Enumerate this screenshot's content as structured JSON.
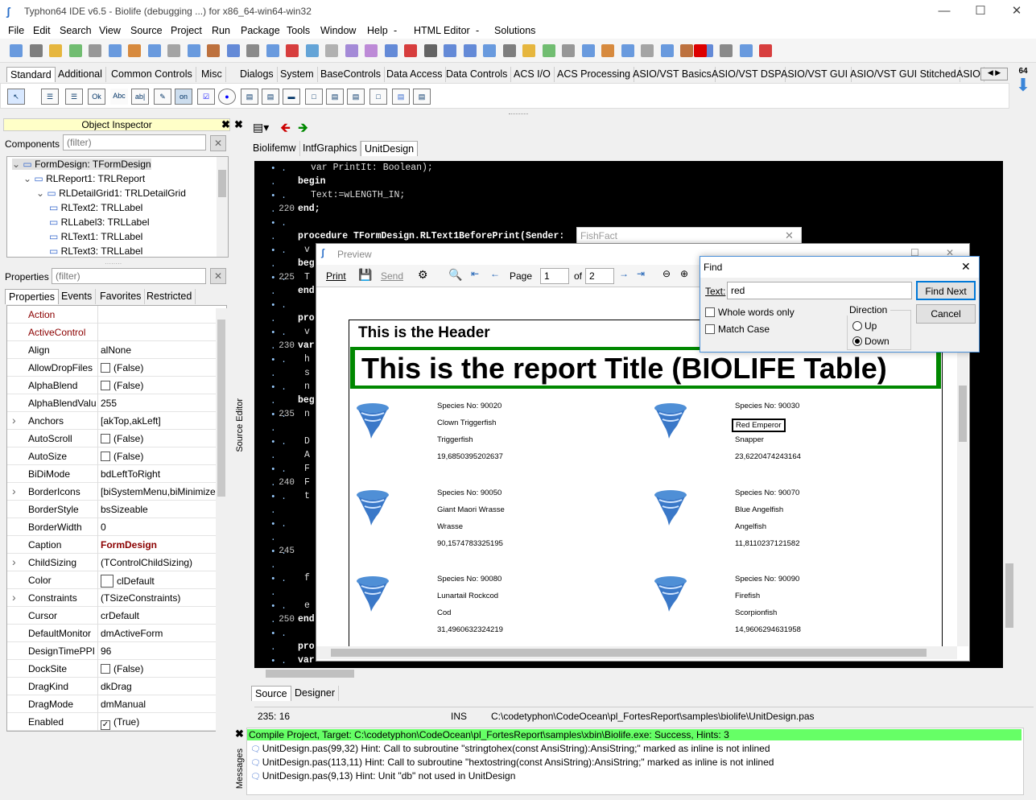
{
  "window": {
    "title": "Typhon64 IDE v6.5 - Biolife (debugging ...) for x86_64-win64-win32"
  },
  "menu": [
    "File",
    "Edit",
    "Search",
    "View",
    "Source",
    "Project",
    "Run",
    "Package",
    "Tools",
    "Window",
    "Help",
    "-",
    "HTML Editor",
    "-",
    "Solutions"
  ],
  "palette_tabs": [
    "Standard",
    "Additional",
    "Common Controls",
    "Misc",
    "Dialogs",
    "System",
    "BaseControls",
    "Data Access",
    "Data Controls",
    "ACS I/O",
    "ACS Processing",
    "ASIO/VST Basics",
    "ASIO/VST DSP",
    "ASIO/VST GUI",
    "ASIO/VST GUI Stitched",
    "ASIO"
  ],
  "palette_badge": "64",
  "palette_icons": [
    "Ok",
    "Abc",
    "ab|",
    "on"
  ],
  "object_inspector": {
    "title": "Object Inspector",
    "components_label": "Components",
    "filter_placeholder": "(filter)",
    "tree": [
      "FormDesign: TFormDesign",
      "RLReport1: TRLReport",
      "RLDetailGrid1: TRLDetailGrid",
      "RLText2: TRLLabel",
      "RLLabel3: TRLLabel",
      "RLText1: TRLLabel",
      "RLText3: TRLLabel"
    ],
    "properties_label": "Properties",
    "tabs": [
      "Properties",
      "Events",
      "Favorites",
      "Restricted"
    ],
    "rows": [
      {
        "n": "Action",
        "v": ""
      },
      {
        "n": "ActiveControl",
        "v": ""
      },
      {
        "n": "Align",
        "v": "alNone"
      },
      {
        "n": "AllowDropFiles",
        "v": "(False)"
      },
      {
        "n": "AlphaBlend",
        "v": "(False)"
      },
      {
        "n": "AlphaBlendValu",
        "v": "255"
      },
      {
        "n": "Anchors",
        "v": "[akTop,akLeft]"
      },
      {
        "n": "AutoScroll",
        "v": "(False)"
      },
      {
        "n": "AutoSize",
        "v": "(False)"
      },
      {
        "n": "BiDiMode",
        "v": "bdLeftToRight"
      },
      {
        "n": "BorderIcons",
        "v": "[biSystemMenu,biMinimize"
      },
      {
        "n": "BorderStyle",
        "v": "bsSizeable"
      },
      {
        "n": "BorderWidth",
        "v": "0"
      },
      {
        "n": "Caption",
        "v": "FormDesign"
      },
      {
        "n": "ChildSizing",
        "v": "(TControlChildSizing)"
      },
      {
        "n": "Color",
        "v": "clDefault"
      },
      {
        "n": "Constraints",
        "v": "(TSizeConstraints)"
      },
      {
        "n": "Cursor",
        "v": "crDefault"
      },
      {
        "n": "DefaultMonitor",
        "v": "dmActiveForm"
      },
      {
        "n": "DesignTimePPI",
        "v": "96"
      },
      {
        "n": "DockSite",
        "v": "(False)"
      },
      {
        "n": "DragKind",
        "v": "dkDrag"
      },
      {
        "n": "DragMode",
        "v": "dmManual"
      },
      {
        "n": "Enabled",
        "v": "(True)"
      }
    ]
  },
  "source_editor": {
    "side_label": "Source Editor",
    "tabs": [
      "Biolifemw",
      "IntfGraphics",
      "UnitDesign"
    ],
    "bottom_tabs": [
      "Source",
      "Designer"
    ],
    "gutter": [
      "220",
      "225",
      "230",
      "235",
      "240",
      "245",
      "250"
    ],
    "lines": [
      "var PrintIt: Boolean);",
      "begin",
      "Text:=wLENGTH_IN;",
      "end;",
      "procedure TFormDesign.RLText1BeforePrint(Sender: ",
      "v",
      "beg",
      "T",
      "end",
      "pro",
      "v",
      "var",
      "h",
      "s",
      "n",
      "beg",
      "n",
      "D",
      "A",
      "F",
      "F",
      "t",
      "f",
      "e",
      "end",
      "pro",
      "var"
    ]
  },
  "fishfact": {
    "title": "FishFact"
  },
  "preview": {
    "title": "Preview",
    "print": "Print",
    "send": "Send",
    "page_label": "Page",
    "page": "1",
    "of_label": "of",
    "total": "2",
    "header": "This is the Header",
    "report_title": "This is the report Title (BIOLIFE Table)",
    "records": [
      [
        "Species No: 90020",
        "Clown Triggerfish",
        "Triggerfish",
        "19,6850395202637"
      ],
      [
        "Species No: 90030",
        "Red Emperor",
        "Snapper",
        "23,6220474243164"
      ],
      [
        "Species No: 90050",
        "Giant Maori Wrasse",
        "Wrasse",
        "90,1574783325195"
      ],
      [
        "Species No: 90070",
        "Blue Angelfish",
        "Angelfish",
        "11,8110237121582"
      ],
      [
        "Species No: 90080",
        "Lunartail Rockcod",
        "Cod",
        "31,4960632324219"
      ],
      [
        "Species No: 90090",
        "Firefish",
        "Scorpionfish",
        "14,9606294631958"
      ]
    ]
  },
  "find": {
    "title": "Find",
    "text_label": "Text:",
    "text_value": "red",
    "find_next": "Find Next",
    "cancel": "Cancel",
    "whole_words": "Whole words only",
    "match_case": "Match Case",
    "direction": "Direction",
    "up": "Up",
    "down": "Down"
  },
  "status": {
    "pos": "235: 16",
    "mode": "INS",
    "path": "C:\\codetyphon\\CodeOcean\\pl_FortesReport\\samples\\biolife\\UnitDesign.pas"
  },
  "messages": {
    "side_label": "Messages",
    "lines": [
      "Compile Project, Target: C:\\codetyphon\\CodeOcean\\pl_FortesReport\\samples\\xbin\\Biolife.exe: Success, Hints: 3",
      "UnitDesign.pas(99,32) Hint: Call to subroutine \"stringtohex(const AnsiString):AnsiString;\" marked as inline is not inlined",
      "UnitDesign.pas(113,11) Hint: Call to subroutine \"hextostring(const AnsiString):AnsiString;\" marked as inline is not inlined",
      "UnitDesign.pas(9,13) Hint: Unit \"db\" not used in UnitDesign"
    ]
  }
}
